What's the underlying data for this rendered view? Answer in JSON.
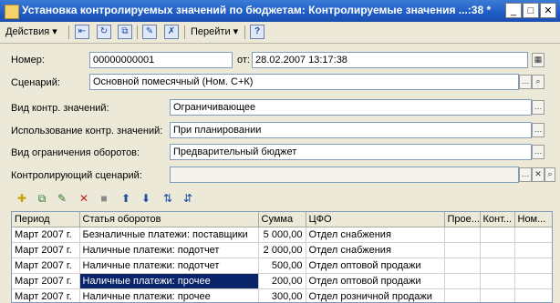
{
  "window": {
    "title": "Установка контролируемых значений по бюджетам: Контролируемые значения ...:38 *",
    "min": "_",
    "max": "□",
    "close": "✕"
  },
  "toolbar": {
    "actions_label": "Действия",
    "goto_label": "Перейти",
    "help_label": "?"
  },
  "form": {
    "number_label": "Номер:",
    "number_value": "00000000001",
    "date_label": "от:",
    "date_value": "28.02.2007 13:17:38",
    "scenario_label": "Сценарий:",
    "scenario_value": "Основной помесячный (Ном. С+К)",
    "control_kind_label": "Вид контр. значений:",
    "control_kind_value": "Ограничивающее",
    "usage_label": "Использование контр. значений:",
    "usage_value": "При планировании",
    "turnover_limit_label": "Вид ограничения оборотов:",
    "turnover_limit_value": "Предварительный бюджет",
    "control_scenario_label": "Контролирующий сценарий:",
    "control_scenario_value": ""
  },
  "grid": {
    "columns": [
      "Период",
      "Статья оборотов",
      "Сумма",
      "ЦФО",
      "Прое...",
      "Конт...",
      "Ном..."
    ],
    "rows": [
      [
        "Март 2007 г.",
        "Безналичные платежи: поставщики",
        "5 000,00",
        "Отдел снабжения",
        "",
        "",
        ""
      ],
      [
        "Март 2007 г.",
        "Наличные платежи: подотчет",
        "2 000,00",
        "Отдел снабжения",
        "",
        "",
        ""
      ],
      [
        "Март 2007 г.",
        "Наличные платежи: подотчет",
        "500,00",
        "Отдел оптовой продажи",
        "",
        "",
        ""
      ],
      [
        "Март 2007 г.",
        "Наличные платежи: прочее",
        "200,00",
        "Отдел оптовой продажи",
        "",
        "",
        ""
      ],
      [
        "Март 2007 г.",
        "Наличные платежи: прочее",
        "300,00",
        "Отдел розничной продажи",
        "",
        "",
        ""
      ]
    ],
    "selected_row": 3,
    "selected_col": 1
  }
}
